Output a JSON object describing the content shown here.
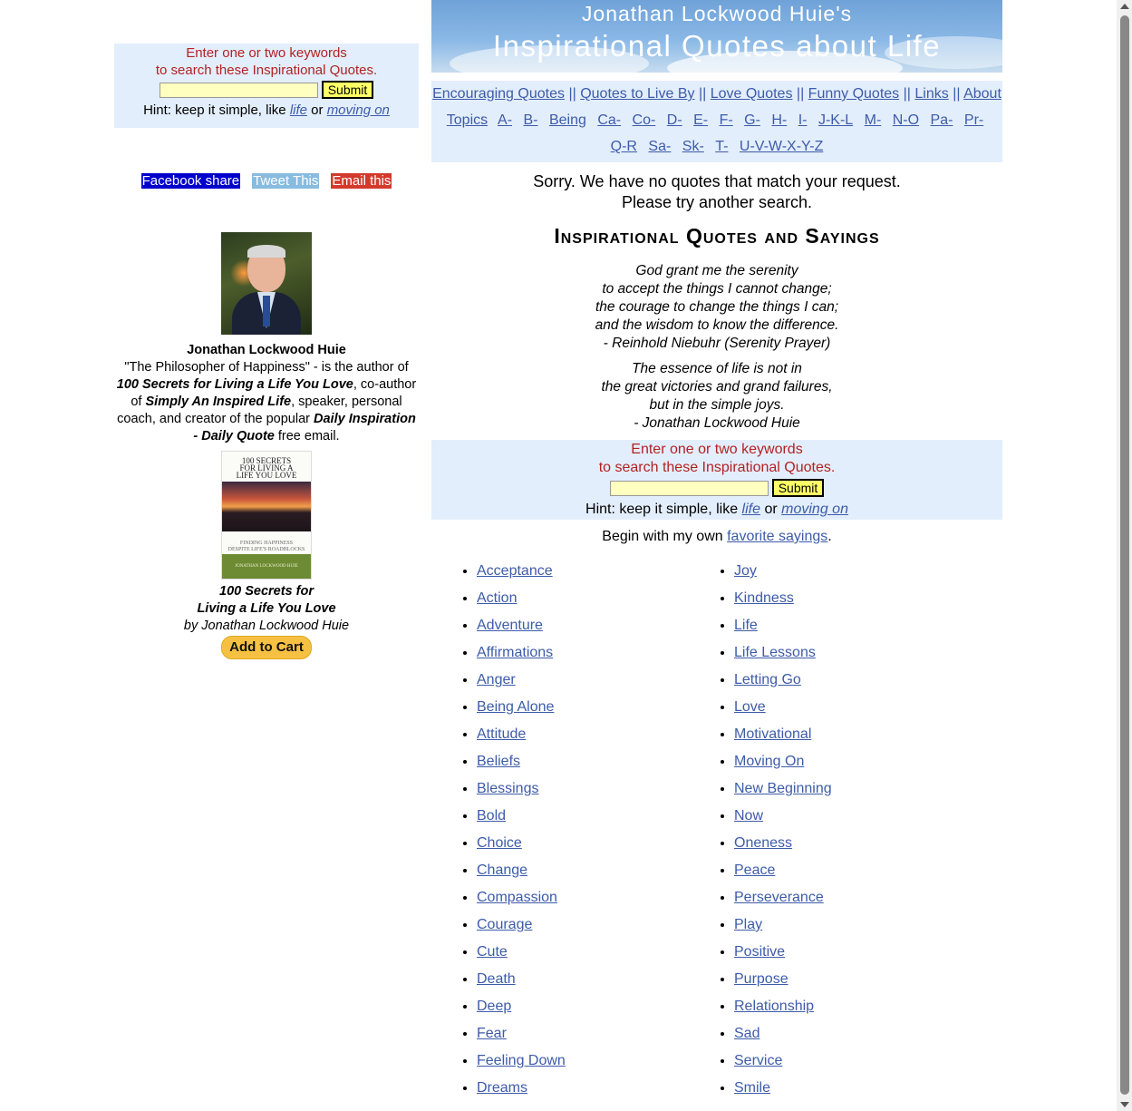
{
  "search": {
    "prompt_line1": "Enter one or two keywords",
    "prompt_line2": "to search these Inspirational Quotes.",
    "input_value": "",
    "submit_label": "Submit",
    "hint_prefix": "Hint: keep it simple, like",
    "hint_link1": "life",
    "hint_or": "or",
    "hint_link2": "moving on"
  },
  "share": {
    "facebook": "Facebook share",
    "tweet": "Tweet This",
    "email": "Email this"
  },
  "author": {
    "name": "Jonathan Lockwood Huie",
    "bio_1": "\"The Philosopher of Happiness\" - is the author of",
    "bio_book1": "100 Secrets for Living a Life You Love",
    "bio_2": ", co-author of",
    "bio_book2": "Simply An Inspired Life",
    "bio_3": ", speaker, personal coach, and creator of the popular",
    "bio_email_name": "Daily Inspiration - Daily Quote",
    "bio_4": "free email."
  },
  "book": {
    "cover_title_1": "100 SECRETS",
    "cover_title_2": "FOR LIVING A",
    "cover_title_3": "LIFE YOU LOVE",
    "cover_sub_1": "FINDING HAPPINESS",
    "cover_sub_2": "DESPITE LIFE'S ROADBLOCKS",
    "cover_author": "JONATHAN LOCKWOOD HUIE",
    "title_line1": "100 Secrets for",
    "title_line2": "Living a Life You Love",
    "by": "by Jonathan Lockwood Huie",
    "cart_label": "Add to Cart"
  },
  "banner": {
    "line1": "Jonathan Lockwood Huie's",
    "line2": "Inspirational Quotes about Life"
  },
  "nav": {
    "links": [
      "Encouraging Quotes",
      "Quotes to Live By",
      "Love Quotes",
      "Funny Quotes",
      "Links",
      "About"
    ],
    "separator": "||",
    "topics_label": "Topics",
    "topics": [
      "A-",
      "B-",
      "Being",
      "Ca-",
      "Co-",
      "D-",
      "E-",
      "F-",
      "G-",
      "H-",
      "I-",
      "J-K-L",
      "M-",
      "N-O",
      "Pa-",
      "Pr-",
      "Q-R",
      "Sa-",
      "Sk-",
      "T-",
      "U-V-W-X-Y-Z"
    ]
  },
  "results": {
    "sorry_line1": "Sorry. We have no quotes that match your request.",
    "sorry_line2": "Please try another search."
  },
  "heading": "Inspirational Quotes and Sayings",
  "quotes": [
    {
      "lines": [
        "God grant me the serenity",
        "to accept the things I cannot change;",
        "the courage to change the things I can;",
        "and the wisdom to know the difference."
      ],
      "author": "- Reinhold Niebuhr (Serenity Prayer)"
    },
    {
      "lines": [
        "The essence of life is not in",
        "the great victories and grand failures,",
        "but in the simple joys."
      ],
      "author": "- Jonathan Lockwood Huie"
    }
  ],
  "begin": {
    "prefix": "Begin with my own",
    "link": "favorite sayings",
    "suffix": "."
  },
  "topics_left": [
    "Acceptance",
    "Action",
    "Adventure",
    "Affirmations",
    "Anger",
    "Being Alone",
    "Attitude",
    "Beliefs",
    "Blessings",
    "Bold",
    "Choice",
    "Change",
    "Compassion",
    "Courage",
    "Cute",
    "Death",
    "Deep",
    "Fear",
    "Feeling Down",
    "Dreams"
  ],
  "topics_right": [
    "Joy",
    "Kindness",
    "Life",
    "Life Lessons",
    "Letting Go",
    "Love",
    "Motivational",
    "Moving On",
    "New Beginning",
    "Now",
    "Oneness",
    "Peace",
    "Perseverance",
    "Play",
    "Positive",
    "Purpose",
    "Relationship",
    "Sad",
    "Service",
    "Smile"
  ]
}
